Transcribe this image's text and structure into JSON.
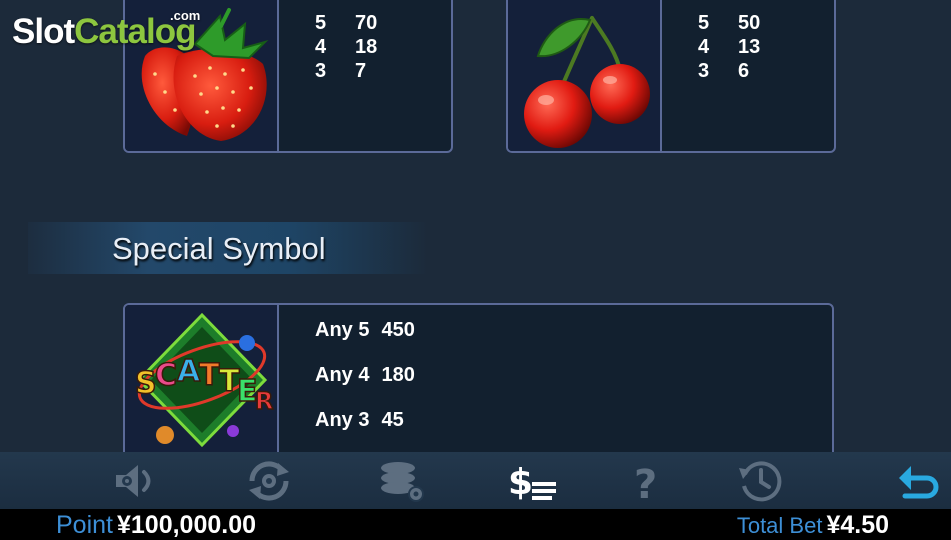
{
  "watermark": {
    "part1": "Slot",
    "part2": "Catalog",
    "domain": ".com"
  },
  "paytables": {
    "strawberry": {
      "icon": "strawberry-icon",
      "rows": [
        {
          "count": "5",
          "payout": "70"
        },
        {
          "count": "4",
          "payout": "18"
        },
        {
          "count": "3",
          "payout": "7"
        }
      ]
    },
    "cherry": {
      "icon": "cherry-icon",
      "rows": [
        {
          "count": "5",
          "payout": "50"
        },
        {
          "count": "4",
          "payout": "13"
        },
        {
          "count": "3",
          "payout": "6"
        }
      ]
    }
  },
  "special": {
    "title": "Special Symbol",
    "scatter": {
      "icon": "scatter-icon",
      "rows": [
        {
          "count": "Any 5",
          "payout": "450"
        },
        {
          "count": "Any 4",
          "payout": "180"
        },
        {
          "count": "Any 3",
          "payout": "45"
        }
      ]
    }
  },
  "toolbar": {
    "buttons": [
      "sound-icon",
      "autoplay-icon",
      "bet-chips-icon",
      "paytable-icon",
      "help-icon",
      "history-icon",
      "back-icon"
    ],
    "active": "paytable-icon",
    "colors": {
      "inactive": "#5d6e80",
      "active": "#ffffff",
      "back": "#29a9e0"
    }
  },
  "status": {
    "point_label": "Point",
    "point_value": "¥100,000.00",
    "bet_label": "Total Bet",
    "bet_value": "¥4.50"
  }
}
